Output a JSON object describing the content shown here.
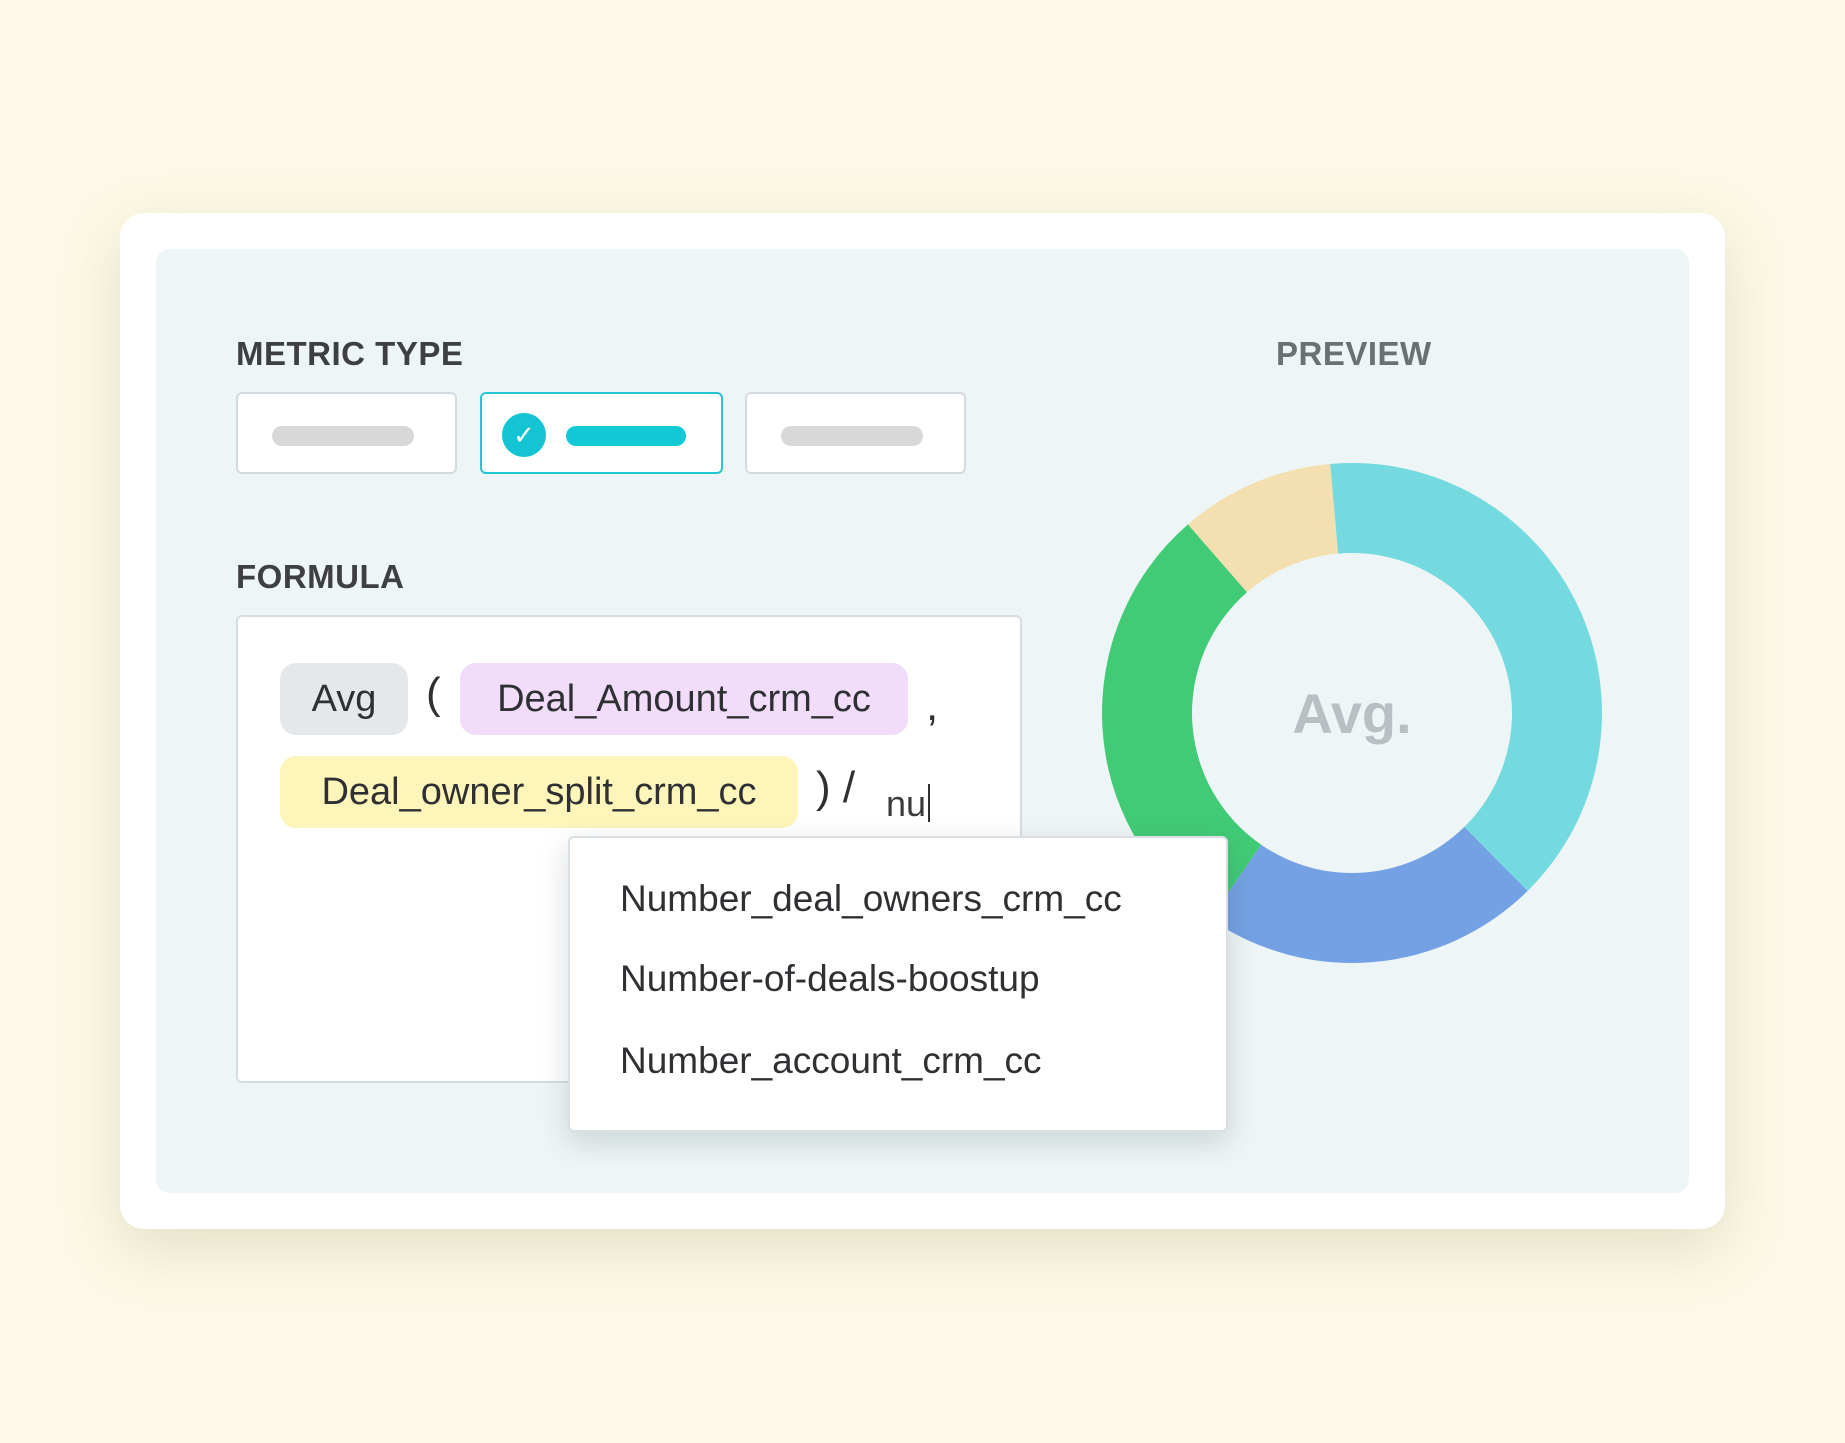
{
  "metric_type": {
    "label": "METRIC TYPE",
    "options": [
      {
        "selected": false
      },
      {
        "selected": true,
        "icon": "check-icon"
      },
      {
        "selected": false
      }
    ]
  },
  "formula": {
    "label": "FORMULA",
    "tokens": {
      "function": "Avg",
      "open_paren": "(",
      "field1": "Deal_Amount_crm_cc",
      "comma": ",",
      "field2": "Deal_owner_split_crm_cc",
      "close_div": ") /",
      "typed": "nu"
    }
  },
  "preview": {
    "label": "PREVIEW",
    "center_label": "Avg."
  },
  "autocomplete": {
    "items": [
      "Number_deal_owners_crm_cc",
      "Number-of-deals-boostup",
      "Number_account_crm_cc"
    ]
  },
  "colors": {
    "accent": "#14c4d3",
    "chip_function": "#e5e8ea",
    "chip_field_purple": "#f1dcfa",
    "chip_field_yellow": "#fdf5b9",
    "donut_cyan": "#74dae0",
    "donut_blue": "#74a1e3",
    "donut_green": "#42cb77",
    "donut_tan": "#f3dfb0"
  },
  "chart_data": {
    "type": "pie",
    "categories": [
      "cyan",
      "blue",
      "green",
      "tan"
    ],
    "values": [
      39,
      22,
      29,
      10
    ],
    "center_label": "Avg."
  }
}
